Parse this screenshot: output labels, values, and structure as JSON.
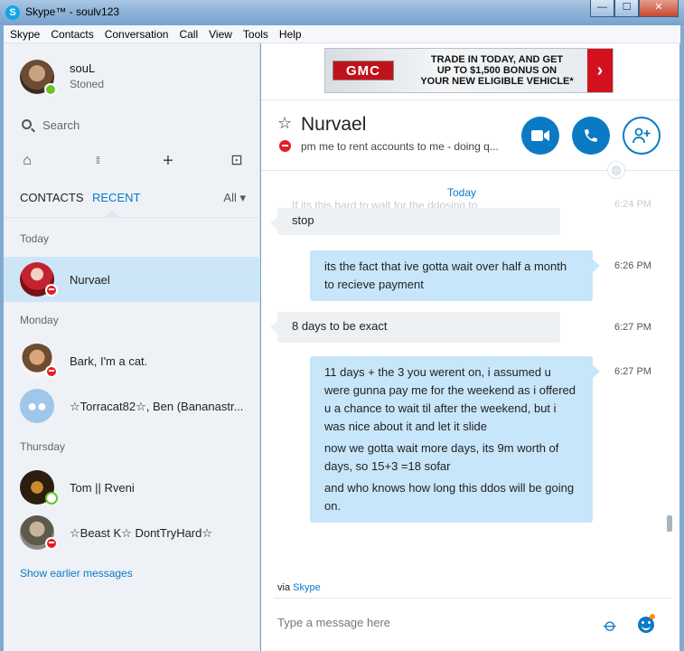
{
  "window": {
    "title": "Skype™ - soulv123",
    "app_icon": "S",
    "minimize": "—",
    "maximize": "☐",
    "close": "✕"
  },
  "menu": [
    "Skype",
    "Contacts",
    "Conversation",
    "Call",
    "View",
    "Tools",
    "Help"
  ],
  "profile": {
    "name": "souL",
    "mood": "Stoned"
  },
  "search": {
    "label": "Search"
  },
  "nav_icons": {
    "home": "⌂",
    "dialpad": "⁞⁞",
    "add": "+",
    "bot": "⊡"
  },
  "tabs": {
    "contacts": "CONTACTS",
    "recent": "RECENT",
    "filter": "All ▾"
  },
  "sections": {
    "today": "Today",
    "monday": "Monday",
    "thursday": "Thursday"
  },
  "contacts": [
    {
      "name": "Nurvael",
      "status": "dnd"
    },
    {
      "name": "Bark, I'm a cat.",
      "status": "dnd"
    },
    {
      "name": "☆Torracat82☆, Ben (Bananastr...",
      "status": "group"
    },
    {
      "name": "Tom || Rveni",
      "status": "offline"
    },
    {
      "name": "☆Beast K☆ DontTryHard☆",
      "status": "dnd"
    }
  ],
  "show_earlier": "Show earlier messages",
  "ad": {
    "brand": "GMC",
    "text": "TRADE IN TODAY, AND GET\nUP TO $1,500 BONUS ON\nYOUR NEW ELIGIBLE VEHICLE*",
    "arrow": "›"
  },
  "conversation": {
    "name": "Nurvael",
    "star": "☆",
    "mood": "pm me to rent accounts to me - doing q...",
    "date": "Today",
    "ghost_text": "If its this hard to wait for the ddosing to",
    "ghost_time": "6:24 PM",
    "messages": [
      {
        "from": "them",
        "lines": [
          "stop"
        ],
        "time": ""
      },
      {
        "from": "me",
        "lines": [
          "its the fact that ive gotta wait over half a month to recieve payment"
        ],
        "time": "6:26 PM"
      },
      {
        "from": "them",
        "lines": [
          "8 days to be exact"
        ],
        "time": "6:27 PM"
      },
      {
        "from": "me",
        "lines": [
          "11 days + the 3 you werent on, i assumed u were gunna pay me for the weekend as i offered u a chance to wait til after the weekend, but i was nice about it and let it slide",
          "now we gotta wait more days, its 9m worth of days, so 15+3 =18 sofar",
          "and who knows how long this ddos will be going on."
        ],
        "time": "6:27 PM"
      }
    ]
  },
  "via": {
    "prefix": "via ",
    "link": "Skype"
  },
  "composer": {
    "placeholder": "Type a message here"
  },
  "colors": {
    "accent": "#0a7ac4",
    "dnd": "#e01f26",
    "online": "#6ec225",
    "bubble_me": "#c8e6fa",
    "bubble_them": "#eef1f4"
  }
}
